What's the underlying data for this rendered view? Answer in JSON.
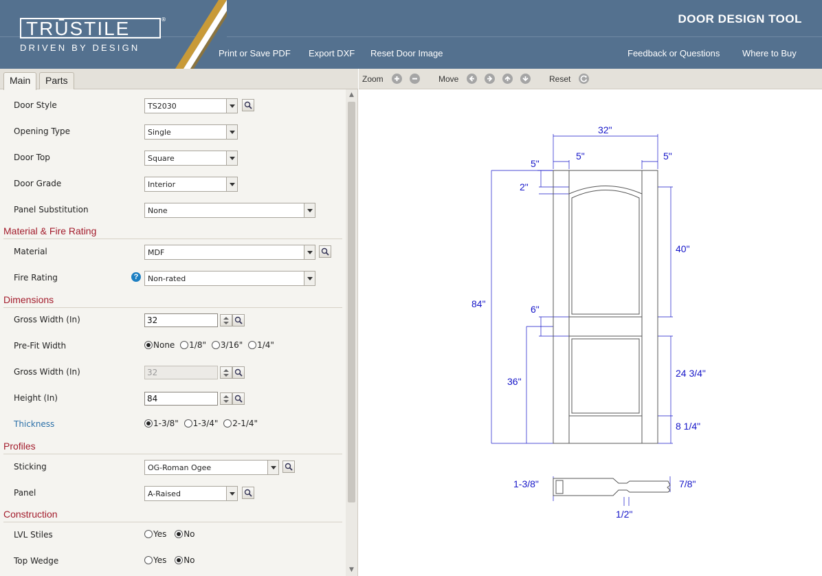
{
  "brand": {
    "logo_text": "TRŪSTILE",
    "tagline": "DRIVEN BY DESIGN",
    "registered": "®"
  },
  "header": {
    "title": "DOOR DESIGN TOOL",
    "links": {
      "print": "Print or Save PDF",
      "export": "Export DXF",
      "reset": "Reset Door Image",
      "feedback": "Feedback or Questions",
      "where": "Where to Buy"
    }
  },
  "tabs": [
    "Main",
    "Parts"
  ],
  "form": {
    "door_style": {
      "label": "Door Style",
      "value": "TS2030"
    },
    "opening_type": {
      "label": "Opening Type",
      "value": "Single"
    },
    "door_top": {
      "label": "Door Top",
      "value": "Square"
    },
    "door_grade": {
      "label": "Door Grade",
      "value": "Interior"
    },
    "panel_sub": {
      "label": "Panel Substitution",
      "value": "None"
    },
    "sec_material": "Material & Fire Rating",
    "material": {
      "label": "Material",
      "value": "MDF"
    },
    "fire_rating": {
      "label": "Fire Rating",
      "value": "Non-rated",
      "help": "?"
    },
    "sec_dimensions": "Dimensions",
    "gross_width": {
      "label": "Gross Width (In)",
      "value": "32"
    },
    "prefit": {
      "label": "Pre-Fit Width",
      "options": [
        "None",
        "1/8\"",
        "3/16\"",
        "1/4\""
      ],
      "selected": "None"
    },
    "gross_width2": {
      "label": "Gross Width (In)",
      "value": "32"
    },
    "height": {
      "label": "Height (In)",
      "value": "84"
    },
    "thickness": {
      "label": "Thickness",
      "options": [
        "1-3/8\"",
        "1-3/4\"",
        "2-1/4\""
      ],
      "selected": "1-3/8\""
    },
    "sec_profiles": "Profiles",
    "sticking": {
      "label": "Sticking",
      "value": "OG-Roman Ogee"
    },
    "panel": {
      "label": "Panel",
      "value": "A-Raised"
    },
    "sec_construction": "Construction",
    "lvl_stiles": {
      "label": "LVL Stiles",
      "options": [
        "Yes",
        "No"
      ],
      "selected": "No"
    },
    "top_wedge": {
      "label": "Top Wedge",
      "options": [
        "Yes",
        "No"
      ],
      "selected": "No"
    }
  },
  "toolbar": {
    "zoom": "Zoom",
    "move": "Move",
    "reset": "Reset"
  },
  "drawing": {
    "width": "32\"",
    "stile_left": "5\"",
    "stile_right": "5\"",
    "top_rail": "5\"",
    "arch": "2\"",
    "upper_panel": "40\"",
    "height": "84\"",
    "mid_rail": "6\"",
    "lock_rail_height": "36\"",
    "lower_panel": "24 3/4\"",
    "bottom_rail": "8 1/4\"",
    "section_thickness": "1-3/8\"",
    "panel_thickness": "7/8\"",
    "panel_tongue": "1/2\""
  },
  "colors": {
    "header_bg": "#54718f",
    "accent_gold": "#b88a2c",
    "section_red": "#a31c2c",
    "dimension_blue": "#1414c8"
  }
}
